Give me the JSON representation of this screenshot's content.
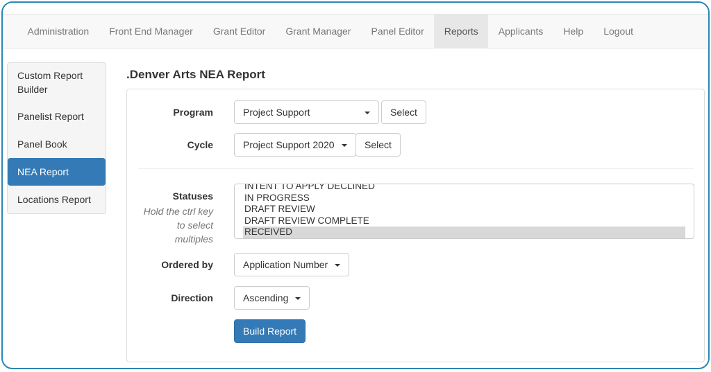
{
  "nav": {
    "items": [
      "Administration",
      "Front End Manager",
      "Grant Editor",
      "Grant Manager",
      "Panel Editor",
      "Reports",
      "Applicants",
      "Help",
      "Logout"
    ],
    "active": "Reports"
  },
  "sidebar": {
    "items": [
      "Custom Report Builder",
      "Panelist Report",
      "Panel Book",
      "NEA Report",
      "Locations Report"
    ],
    "active": "NEA Report"
  },
  "page": {
    "title": ".Denver Arts NEA Report"
  },
  "form": {
    "program": {
      "label": "Program",
      "value": "Project Support",
      "select": "Select"
    },
    "cycle": {
      "label": "Cycle",
      "value": "Project Support 2020",
      "select": "Select"
    },
    "statuses": {
      "label": "Statuses",
      "help": "Hold the ctrl key to select multiples",
      "options": [
        "INTENT TO APPLY DECLINED",
        "IN PROGRESS",
        "DRAFT REVIEW",
        "DRAFT REVIEW COMPLETE",
        "RECEIVED"
      ],
      "selected": "RECEIVED"
    },
    "ordered_by": {
      "label": "Ordered by",
      "value": "Application Number"
    },
    "direction": {
      "label": "Direction",
      "value": "Ascending"
    },
    "build": "Build Report"
  },
  "colors": {
    "primary": "#337ab7",
    "frame": "#2b86b4"
  }
}
